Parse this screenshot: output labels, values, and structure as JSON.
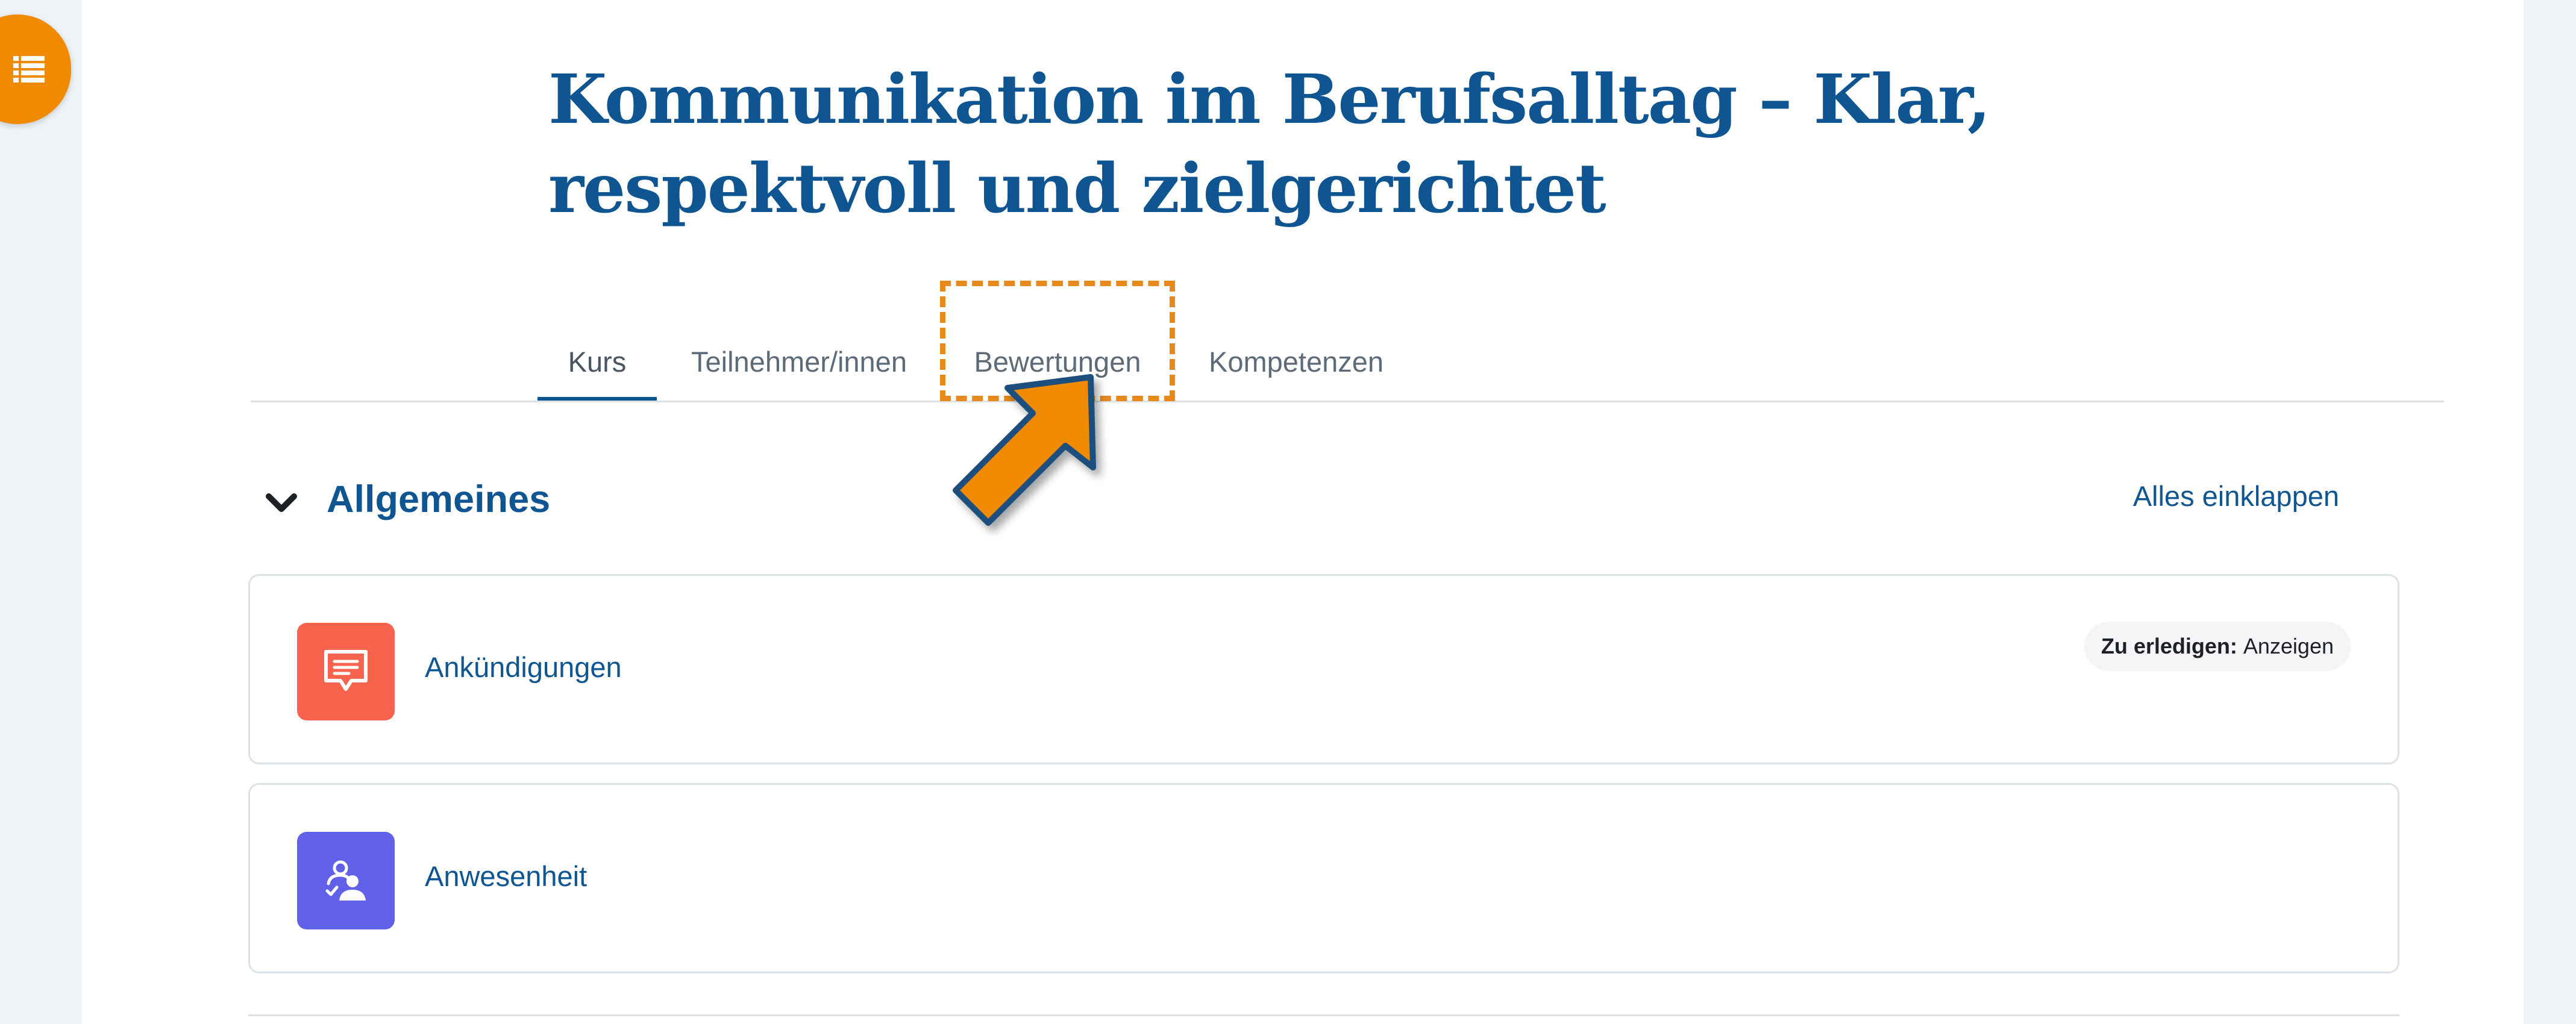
{
  "course": {
    "title": "Kommunikation im Berufsalltag – Klar, respektvoll und zielgerichtet"
  },
  "drawer": {
    "icon": "list-icon"
  },
  "tabs": [
    {
      "label": "Kurs",
      "active": true
    },
    {
      "label": "Teilnehmer/innen",
      "active": false
    },
    {
      "label": "Bewertungen",
      "active": false,
      "highlighted": true
    },
    {
      "label": "Kompetenzen",
      "active": false
    }
  ],
  "section": {
    "title": "Allgemeines",
    "collapse_label": "Alles einklappen",
    "chevron_icon": "chevron-down-icon"
  },
  "activities": [
    {
      "name": "Ankündigungen",
      "icon": "forum-icon",
      "color": "#f7634d",
      "todo": {
        "label": "Zu erledigen:",
        "value": "Anzeigen"
      }
    },
    {
      "name": "Anwesenheit",
      "icon": "attendance-icon",
      "color": "#6061e8"
    }
  ],
  "colors": {
    "brand": "#0f5591",
    "accent": "#f08a00",
    "highlight": "#e8891b"
  }
}
